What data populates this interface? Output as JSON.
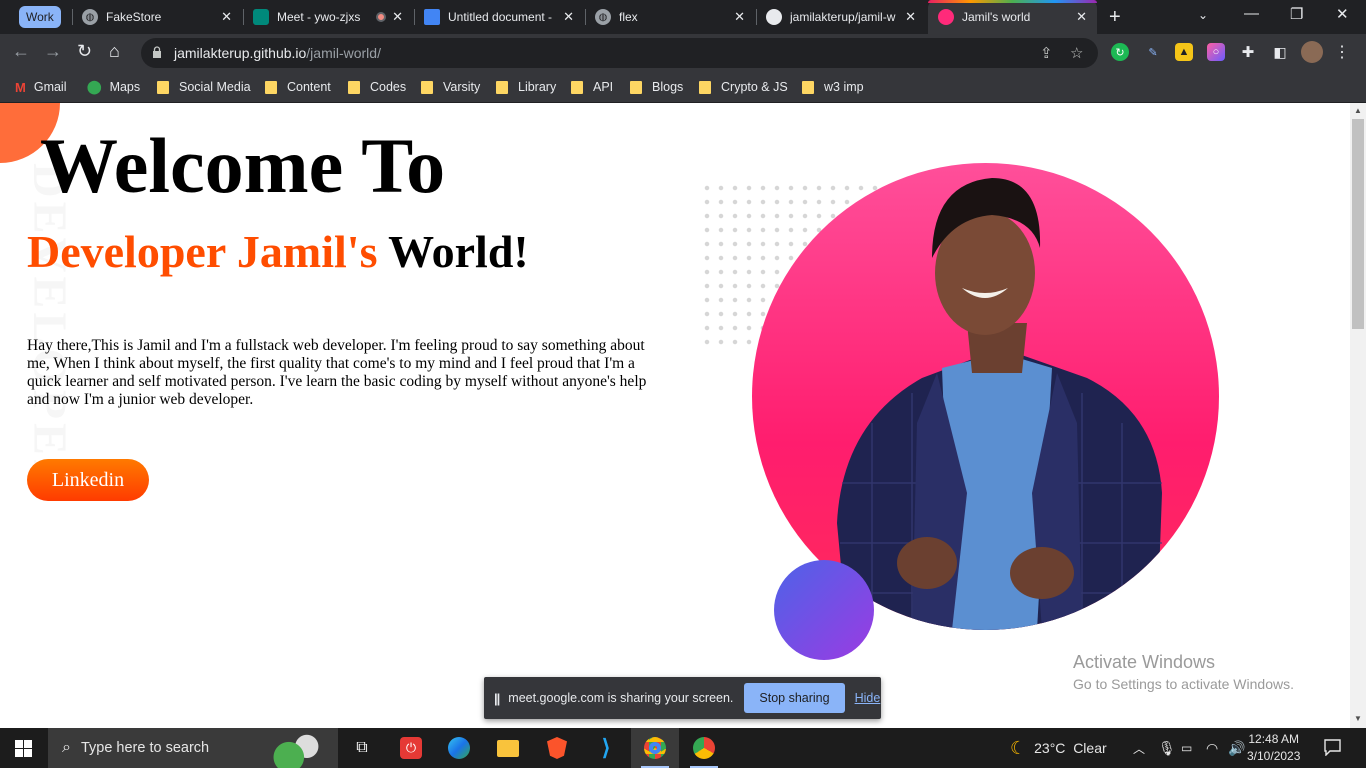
{
  "browser": {
    "tab_group_label": "Work",
    "tabs": [
      {
        "title": "FakeStore"
      },
      {
        "title": "Meet - ywo-zjxs"
      },
      {
        "title": "Untitled document - "
      },
      {
        "title": "flex"
      },
      {
        "title": "jamilakterup/jamil-w"
      },
      {
        "title": "Jamil's world",
        "active": true
      }
    ],
    "url_host": "jamilakterup.github.io",
    "url_path": "/jamil-world/",
    "bookmarks": [
      "Gmail",
      "Maps",
      "Social Media",
      "Content",
      "Codes",
      "Varsity",
      "Library",
      "API",
      "Blogs",
      "Crypto & JS",
      "w3 imp"
    ]
  },
  "page": {
    "welcome": "Welcome To",
    "subtitle_orange": "Developer Jamil's",
    "subtitle_dark": "World!",
    "vertical_watermark": "DEVELOPER",
    "intro": "Hay there,This is Jamil and I'm a fullstack web developer. I'm feeling proud to say something about me, When I think about myself, the first quality that come's to my mind and I feel proud that I'm a quick learner and self motivated person. I've learn the basic coding by myself without anyone's help and now I'm a junior web developer.",
    "linkedin_label": "Linkedin",
    "colors": {
      "accent_orange": "#ff4d00",
      "circle_pink": "#ff1d6e",
      "circle_purple": "#7b4fe4"
    }
  },
  "activation": {
    "title": "Activate Windows",
    "subtitle": "Go to Settings to activate Windows."
  },
  "sharebar": {
    "message": "meet.google.com is sharing your screen.",
    "stop_label": "Stop sharing",
    "hide_label": "Hide"
  },
  "taskbar": {
    "search_placeholder": "Type here to search",
    "weather": "23°C  Clear",
    "time": "12:48 AM",
    "date": "3/10/2023"
  }
}
